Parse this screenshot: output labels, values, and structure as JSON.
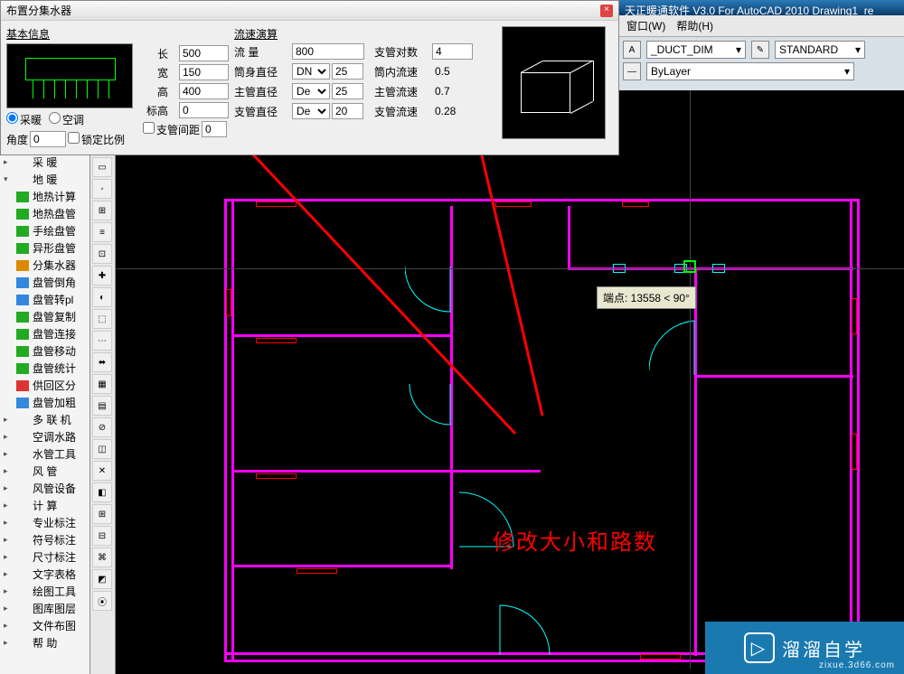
{
  "app": {
    "title_fragment": "天正暖通软件 V3.0 For AutoCAD 2010   Drawing1_re",
    "menu_window": "窗口(W)",
    "menu_help": "帮助(H)",
    "style_combo1": "_DUCT_DIM",
    "style_combo2": "STANDARD",
    "layer_combo": "ByLayer"
  },
  "dialog": {
    "title": "布置分集水器",
    "close": "×",
    "basic_group": "基本信息",
    "radio_heating": "采暖",
    "radio_ac": "空调",
    "angle_label": "角度",
    "angle_value": "0",
    "lock_ratio": "锁定比例",
    "branch_spacing": "支管间距",
    "branch_spacing_value": "0",
    "dim": {
      "len_label": "长",
      "len_value": "500",
      "wid_label": "宽",
      "wid_value": "150",
      "hgt_label": "高",
      "hgt_value": "400",
      "elev_label": "标高",
      "elev_value": "0"
    },
    "flow_group": "流速演算",
    "flow": {
      "flow_label": "流  量",
      "flow_value": "800",
      "branch_count_label": "支管对数",
      "branch_count_value": "4",
      "body_dia_label": "筒身直径",
      "body_dia_unit": "DN",
      "body_dia_value": "25",
      "body_vel_label": "筒内流速",
      "body_vel_value": "0.5",
      "main_dia_label": "主管直径",
      "main_dia_unit": "De",
      "main_dia_value": "25",
      "main_vel_label": "主管流速",
      "main_vel_value": "0.7",
      "branch_dia_label": "支管直径",
      "branch_dia_unit": "De",
      "branch_dia_value": "20",
      "branch_vel_label": "支管流速",
      "branch_vel_value": "0.28"
    }
  },
  "tree": {
    "items": [
      {
        "arrow": "▸",
        "label": "采   暖",
        "icon": ""
      },
      {
        "arrow": "▾",
        "label": "地   暖",
        "icon": ""
      },
      {
        "arrow": "",
        "label": "地热计算",
        "icon": "ico-g"
      },
      {
        "arrow": "",
        "label": "地热盘管",
        "icon": "ico-g"
      },
      {
        "arrow": "",
        "label": "手绘盘管",
        "icon": "ico-g"
      },
      {
        "arrow": "",
        "label": "异形盘管",
        "icon": "ico-g"
      },
      {
        "arrow": "",
        "label": "分集水器",
        "icon": "ico-o"
      },
      {
        "arrow": "",
        "label": "盘管倒角",
        "icon": "ico-b"
      },
      {
        "arrow": "",
        "label": "盘管转pl",
        "icon": "ico-b"
      },
      {
        "arrow": "",
        "label": "盘管复制",
        "icon": "ico-g"
      },
      {
        "arrow": "",
        "label": "盘管连接",
        "icon": "ico-g"
      },
      {
        "arrow": "",
        "label": "盘管移动",
        "icon": "ico-g"
      },
      {
        "arrow": "",
        "label": "盘管统计",
        "icon": "ico-g"
      },
      {
        "arrow": "",
        "label": "供回区分",
        "icon": "ico-r"
      },
      {
        "arrow": "",
        "label": "盘管加粗",
        "icon": "ico-b"
      },
      {
        "arrow": "▸",
        "label": "多 联 机",
        "icon": ""
      },
      {
        "arrow": "▸",
        "label": "空调水路",
        "icon": ""
      },
      {
        "arrow": "▸",
        "label": "水管工具",
        "icon": ""
      },
      {
        "arrow": "▸",
        "label": "风   管",
        "icon": ""
      },
      {
        "arrow": "▸",
        "label": "风管设备",
        "icon": ""
      },
      {
        "arrow": "▸",
        "label": "计   算",
        "icon": ""
      },
      {
        "arrow": "▸",
        "label": "专业标注",
        "icon": ""
      },
      {
        "arrow": "▸",
        "label": "符号标注",
        "icon": ""
      },
      {
        "arrow": "▸",
        "label": "尺寸标注",
        "icon": ""
      },
      {
        "arrow": "▸",
        "label": "文字表格",
        "icon": ""
      },
      {
        "arrow": "▸",
        "label": "绘图工具",
        "icon": ""
      },
      {
        "arrow": "▸",
        "label": "图库图层",
        "icon": ""
      },
      {
        "arrow": "▸",
        "label": "文件布图",
        "icon": ""
      },
      {
        "arrow": "▸",
        "label": "帮   助",
        "icon": ""
      }
    ]
  },
  "tooltip": "端点: 13558 < 90°",
  "annotation": "修改大小和路数",
  "watermark": {
    "text": "溜溜自学",
    "sub": "zixue.3d66.com"
  }
}
